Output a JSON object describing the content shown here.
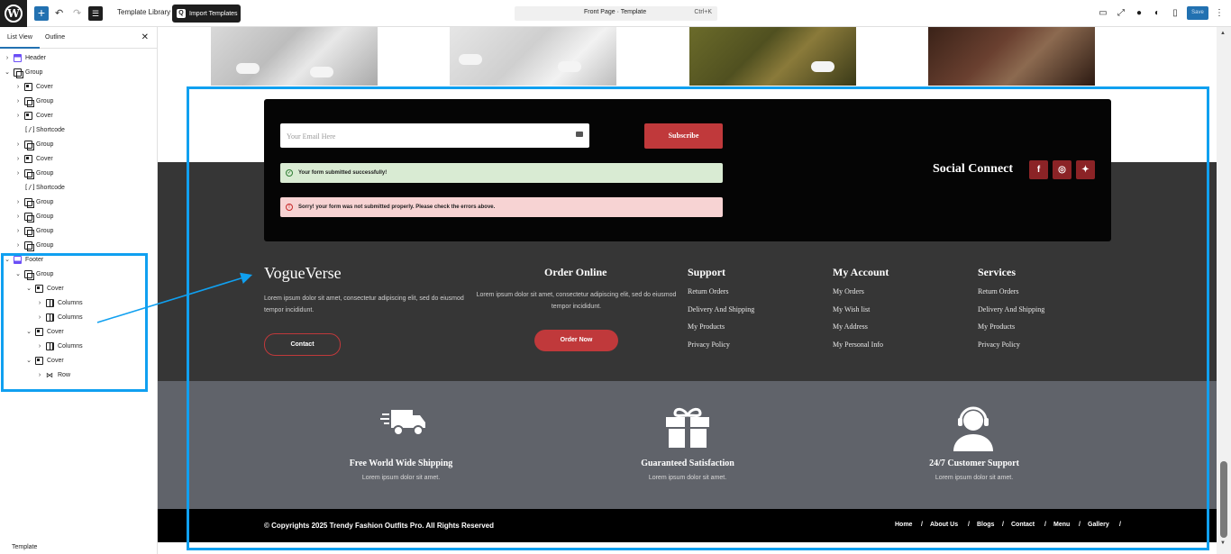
{
  "topbar": {
    "template_library": "Template Library",
    "import_templates": "Import Templates",
    "document_title": "Front Page · Template",
    "shortcut": "Ctrl+K",
    "save": "Save"
  },
  "sidebar": {
    "tabs": [
      "List View",
      "Outline"
    ],
    "active_tab": "List View",
    "footer_label": "Template",
    "tree": [
      {
        "label": "Header",
        "type": "header",
        "level": 0,
        "chevron": "›"
      },
      {
        "label": "Group",
        "type": "group",
        "level": 0,
        "chevron": "⌄"
      },
      {
        "label": "Cover",
        "type": "cover",
        "level": 1,
        "chevron": "›"
      },
      {
        "label": "Group",
        "type": "group",
        "level": 1,
        "chevron": "›"
      },
      {
        "label": "Cover",
        "type": "cover",
        "level": 1,
        "chevron": "›"
      },
      {
        "label": "Shortcode",
        "type": "sc",
        "level": 1,
        "chevron": ""
      },
      {
        "label": "Group",
        "type": "group",
        "level": 1,
        "chevron": "›"
      },
      {
        "label": "Cover",
        "type": "cover",
        "level": 1,
        "chevron": "›"
      },
      {
        "label": "Group",
        "type": "group",
        "level": 1,
        "chevron": "›"
      },
      {
        "label": "Shortcode",
        "type": "sc",
        "level": 1,
        "chevron": ""
      },
      {
        "label": "Group",
        "type": "group",
        "level": 1,
        "chevron": "›"
      },
      {
        "label": "Group",
        "type": "group",
        "level": 1,
        "chevron": "›"
      },
      {
        "label": "Group",
        "type": "group",
        "level": 1,
        "chevron": "›"
      },
      {
        "label": "Group",
        "type": "group",
        "level": 1,
        "chevron": "›"
      },
      {
        "label": "Footer",
        "type": "footer",
        "level": 0,
        "chevron": "⌄"
      },
      {
        "label": "Group",
        "type": "group",
        "level": 1,
        "chevron": "⌄"
      },
      {
        "label": "Cover",
        "type": "cover",
        "level": 2,
        "chevron": "⌄"
      },
      {
        "label": "Columns",
        "type": "columns",
        "level": 3,
        "chevron": "›"
      },
      {
        "label": "Columns",
        "type": "columns",
        "level": 3,
        "chevron": "›"
      },
      {
        "label": "Cover",
        "type": "cover",
        "level": 2,
        "chevron": "⌄"
      },
      {
        "label": "Columns",
        "type": "columns",
        "level": 3,
        "chevron": "›"
      },
      {
        "label": "Cover",
        "type": "cover",
        "level": 2,
        "chevron": "⌄"
      },
      {
        "label": "Row",
        "type": "row",
        "level": 3,
        "chevron": "›"
      }
    ]
  },
  "newsletter": {
    "email_placeholder": "Your Email Here",
    "subscribe_label": "Subscribe",
    "success_message": "Your form submitted successfully!",
    "error_message": "Sorry! your form was not submitted properly. Please check the errors above.",
    "social_title": "Social Connect",
    "social_icons": [
      "facebook-icon",
      "instagram-icon",
      "twitter-icon"
    ]
  },
  "footer": {
    "brand": "VogueVerse",
    "brand_text": "Lorem ipsum dolor sit amet, consectetur adipiscing elit, sed do eiusmod tempor incididunt.",
    "contact_label": "Contact",
    "order_title": "Order Online",
    "order_text": "Lorem ipsum dolor sit amet, consectetur adipiscing elit, sed do eiusmod tempor incididunt.",
    "order_label": "Order Now",
    "columns": [
      {
        "title": "Support",
        "links": [
          "Return Orders",
          "Delivery And Shipping",
          "My Products",
          "Privacy Policy"
        ]
      },
      {
        "title": "My Account",
        "links": [
          "My Orders",
          "My Wish list",
          "My Address",
          "My Personal Info"
        ]
      },
      {
        "title": "Services",
        "links": [
          "Return Orders",
          "Delivery And Shipping",
          "My Products",
          "Privacy Policy"
        ]
      }
    ]
  },
  "features": [
    {
      "icon": "truck-icon",
      "title": "Free World Wide Shipping",
      "subtitle": "Lorem ipsum dolor sit amet."
    },
    {
      "icon": "gift-icon",
      "title": "Guaranteed Satisfaction",
      "subtitle": "Lorem ipsum dolor sit amet."
    },
    {
      "icon": "headset-icon",
      "title": "24/7 Customer Support",
      "subtitle": "Lorem ipsum dolor sit amet."
    }
  ],
  "copyright": {
    "text": "© Copyrights 2025 Trendy Fashion Outfits Pro. All Rights Reserved",
    "nav": [
      "Home",
      "About Us",
      "Blogs",
      "Contact",
      "Menu",
      "Gallery"
    ],
    "separator": "/"
  },
  "colors": {
    "accent": "#c0393b",
    "highlight": "#10a0f0",
    "wp_blue": "#2271b1"
  }
}
